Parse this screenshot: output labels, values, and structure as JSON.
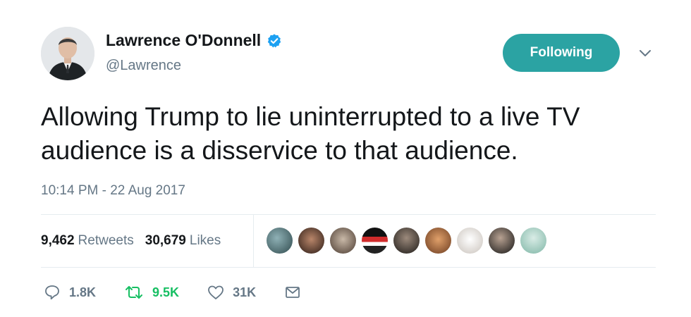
{
  "author": {
    "name": "Lawrence O'Donnell",
    "handle": "@Lawrence",
    "verified": true,
    "avatar_icon": "profile-photo"
  },
  "follow_button": {
    "label": "Following",
    "color": "#2ba3a3"
  },
  "menu_icon": "chevron-down-icon",
  "tweet_text": "Allowing Trump to lie uninterrupted to a live TV audience is a disservice to that audience.",
  "timestamp": "10:14 PM - 22 Aug 2017",
  "stats": {
    "retweets_count": "9,462",
    "retweets_label": "Retweets",
    "likes_count": "30,679",
    "likes_label": "Likes"
  },
  "likers_avatar_count": 9,
  "actions": {
    "replies": "1.8K",
    "retweets": "9.5K",
    "likes": "31K"
  },
  "colors": {
    "text": "#14171a",
    "muted": "#657786",
    "verified": "#1da1f2",
    "retweet_active": "#17bf63",
    "divider": "#e6ecf0"
  }
}
